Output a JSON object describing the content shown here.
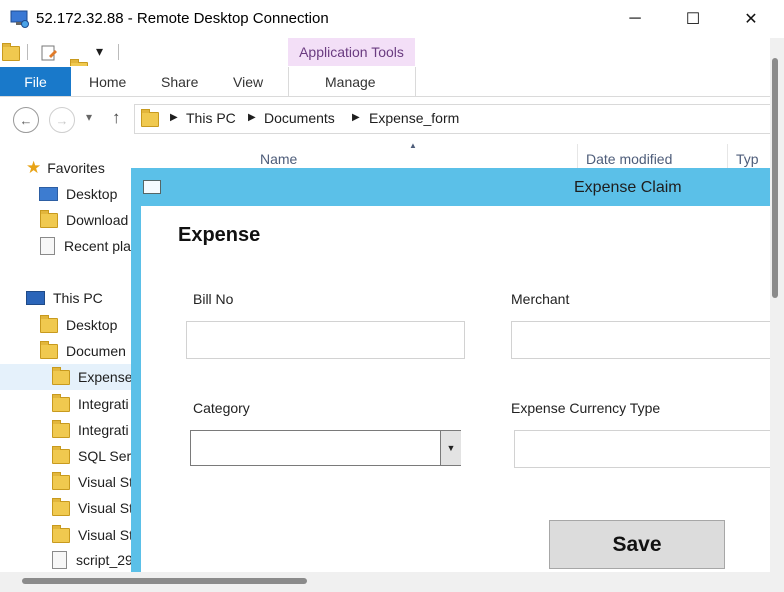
{
  "rdp": {
    "title": "52.172.32.88 - Remote Desktop Connection",
    "minimize_glyph": "─",
    "maximize_glyph": "☐",
    "close_glyph": "✕"
  },
  "ribbon": {
    "context_group": "Application Tools",
    "file_tab": "File",
    "tabs": [
      "Home",
      "Share",
      "View",
      "Manage"
    ],
    "qat_dropdown": "▾"
  },
  "nav": {
    "back_glyph": "←",
    "forward_glyph": "→",
    "recent_glyph": "▾",
    "up_glyph": "↑"
  },
  "address": {
    "crumbs": [
      "This PC",
      "Documents",
      "Expense_form"
    ],
    "sep": "▶"
  },
  "columns": {
    "name": "Name",
    "date_modified": "Date modified",
    "type": "Typ",
    "sort_glyph": "▲"
  },
  "navpane": {
    "favorites": "Favorites",
    "desktop_fav": "Desktop",
    "downloads": "Download",
    "recent": "Recent pla",
    "this_pc": "This PC",
    "desktop_pc": "Desktop",
    "documents": "Documen",
    "folders": [
      "Expense",
      "Integrati",
      "Integrati",
      "SQL Serv",
      "Visual St",
      "Visual St",
      "Visual St",
      "script_29"
    ]
  },
  "app": {
    "window_title": "Expense Claim",
    "heading": "Expense",
    "bill_no_label": "Bill No",
    "bill_no_value": "",
    "merchant_label": "Merchant",
    "merchant_value": "",
    "category_label": "Category",
    "category_value": "",
    "category_arrow": "▼",
    "currency_label": "Expense Currency Type",
    "currency_value": "",
    "save_label": "Save"
  },
  "colors": {
    "app_accent": "#5bc0e8",
    "file_tab": "#1979ca",
    "context_tab": "#f3dff7"
  }
}
